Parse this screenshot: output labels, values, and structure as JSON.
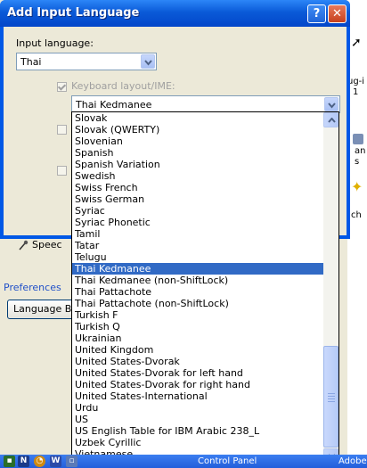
{
  "dialog": {
    "title": "Add Input Language",
    "help_label": "?",
    "close_label": "✕",
    "input_language_label": "Input language:",
    "input_language_value": "Thai",
    "keyboard_layout_label": "Keyboard layout/IME:",
    "keyboard_layout_value": "Thai Kedmanee"
  },
  "dropdown": {
    "items": [
      "Slovak",
      "Slovak (QWERTY)",
      "Slovenian",
      "Spanish",
      "Spanish Variation",
      "Swedish",
      "Swiss French",
      "Swiss German",
      "Syriac",
      "Syriac Phonetic",
      "Tamil",
      "Tatar",
      "Telugu",
      "Thai Kedmanee",
      "Thai Kedmanee (non-ShiftLock)",
      "Thai Pattachote",
      "Thai Pattachote (non-ShiftLock)",
      "Turkish F",
      "Turkish Q",
      "Ukrainian",
      "United Kingdom",
      "United States-Dvorak",
      "United States-Dvorak for left hand",
      "United States-Dvorak for right hand",
      "United States-International",
      "Urdu",
      "US",
      "US English Table for IBM Arabic 238_L",
      "Uzbek Cyrillic",
      "Vietnamese"
    ],
    "selected_index": 13
  },
  "background": {
    "speech_label": "Speec",
    "preferences_label": "Preferences",
    "language_bar_label": "Language Ba",
    "right_fragment_1": "ug-i",
    "right_fragment_2": "1",
    "right_fragment_3": "an",
    "right_fragment_4": "s",
    "right_fragment_5": "ch"
  },
  "taskbar": {
    "item_label": "Control Panel",
    "right_label": "Adobe"
  },
  "colors": {
    "title_blue": "#0a5ad8",
    "selection": "#316ac5",
    "dialog_face": "#ece9d8"
  }
}
